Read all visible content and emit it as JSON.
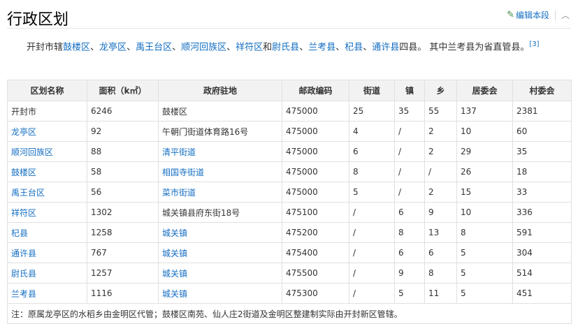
{
  "title": "行政区划",
  "edit": {
    "icon": "pencil-icon",
    "label": "编辑本段",
    "collapse_icon": "chevron-up-icon"
  },
  "intro": {
    "prefix": "开封市辖",
    "districts": [
      "鼓楼区",
      "龙亭区",
      "禹王台区",
      "顺河回族区",
      "祥符区"
    ],
    "and": "和",
    "counties": [
      "尉氏县",
      "兰考县",
      "杞县",
      "通许县"
    ],
    "suffix": "四县。 其中兰考县为省直管县。",
    "ref": "[3]",
    "sep": "、"
  },
  "table": {
    "headers": [
      "区划名称",
      "面积（k㎡）",
      "政府驻地",
      "邮政编码",
      "街道",
      "镇",
      "乡",
      "居委会",
      "村委会"
    ],
    "rows": [
      {
        "name": "开封市",
        "name_link": false,
        "area": "6246",
        "seat": "鼓楼区",
        "seat_link": false,
        "postal": "475000",
        "streets": "25",
        "towns": "35",
        "townships": "55",
        "residents": "137",
        "villages": "2381"
      },
      {
        "name": "龙亭区",
        "name_link": true,
        "area": "92",
        "seat": "午朝门街道体育路16号",
        "seat_link": false,
        "postal": "475000",
        "streets": "4",
        "towns": "/",
        "townships": "2",
        "residents": "10",
        "villages": "60"
      },
      {
        "name": "顺河回族区",
        "name_link": true,
        "area": "88",
        "seat": "清平街道",
        "seat_link": true,
        "postal": "475000",
        "streets": "6",
        "towns": "/",
        "townships": "2",
        "residents": "29",
        "villages": "35"
      },
      {
        "name": "鼓楼区",
        "name_link": true,
        "area": "58",
        "seat": "相国寺街道",
        "seat_link": true,
        "postal": "475000",
        "streets": "8",
        "towns": "/",
        "townships": "/",
        "residents": "26",
        "villages": "18"
      },
      {
        "name": "禹王台区",
        "name_link": true,
        "area": "56",
        "seat": "菜市街道",
        "seat_link": true,
        "postal": "475000",
        "streets": "5",
        "towns": "/",
        "townships": "2",
        "residents": "15",
        "villages": "33"
      },
      {
        "name": "祥符区",
        "name_link": true,
        "area": "1302",
        "seat": "城关镇县府东街18号",
        "seat_link": false,
        "postal": "475100",
        "streets": "/",
        "towns": "6",
        "townships": "9",
        "residents": "10",
        "villages": "336"
      },
      {
        "name": "杞县",
        "name_link": true,
        "area": "1258",
        "seat": "城关镇",
        "seat_link": true,
        "postal": "475200",
        "streets": "/",
        "towns": "8",
        "townships": "13",
        "residents": "8",
        "villages": "591"
      },
      {
        "name": "通许县",
        "name_link": true,
        "area": "767",
        "seat": "城关镇",
        "seat_link": true,
        "postal": "475400",
        "streets": "/",
        "towns": "6",
        "townships": "6",
        "residents": "5",
        "villages": "304"
      },
      {
        "name": "尉氏县",
        "name_link": true,
        "area": "1257",
        "seat": "城关镇",
        "seat_link": true,
        "postal": "475500",
        "streets": "/",
        "towns": "9",
        "townships": "8",
        "residents": "5",
        "villages": "514"
      },
      {
        "name": "兰考县",
        "name_link": true,
        "area": "1116",
        "seat": "城关镇",
        "seat_link": true,
        "postal": "475300",
        "streets": "/",
        "towns": "5",
        "townships": "11",
        "residents": "5",
        "villages": "451"
      }
    ],
    "note": "注：原属龙亭区的水稻乡由金明区代管；鼓楼区南苑、仙人庄2街道及金明区整建制实际由开封新区管辖。"
  },
  "colors": {
    "link": "#136ec2",
    "header_bg": "#f2f2f2",
    "border": "#e0e0e0",
    "edit_icon": "#3a8c3f"
  }
}
